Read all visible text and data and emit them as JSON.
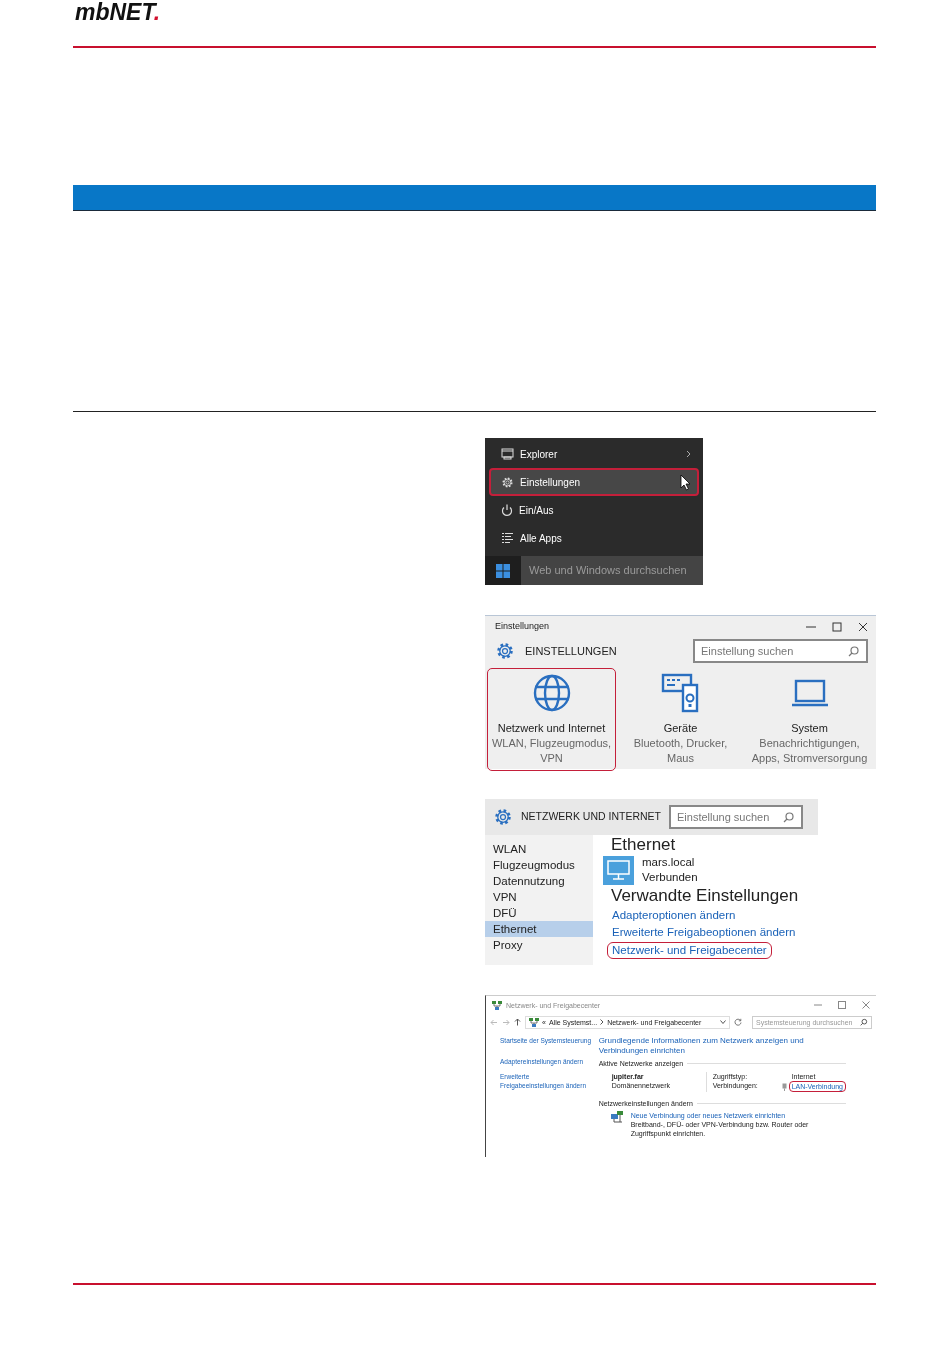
{
  "logo": {
    "text": "mbNET",
    "dot": "."
  },
  "start_menu": {
    "items": [
      {
        "label": "Explorer",
        "kind": "explorer",
        "submenu": true,
        "highlighted": false
      },
      {
        "label": "Einstellungen",
        "kind": "settings",
        "submenu": false,
        "highlighted": true
      },
      {
        "label": "Ein/Aus",
        "kind": "power",
        "submenu": false,
        "highlighted": false
      },
      {
        "label": "Alle Apps",
        "kind": "apps",
        "submenu": false,
        "highlighted": false
      }
    ],
    "search": {
      "placeholder": "Web und Windows durchsuchen"
    }
  },
  "settings_window": {
    "title": "Einstellungen",
    "heading": "EINSTELLUNGEN",
    "search": {
      "placeholder": "Einstellung suchen"
    },
    "tiles": [
      {
        "kind": "network",
        "title": "Netzwerk und Internet",
        "subtitle": "WLAN, Flugzeugmodus, VPN",
        "highlighted": true
      },
      {
        "kind": "devices",
        "title": "Geräte",
        "subtitle": "Bluetooth, Drucker, Maus",
        "highlighted": false
      },
      {
        "kind": "system",
        "title": "System",
        "subtitle": "Benachrichtigungen, Apps, Stromversorgung",
        "highlighted": false
      }
    ]
  },
  "network_settings": {
    "heading": "NETZWERK UND INTERNET",
    "search": {
      "placeholder": "Einstellung suchen"
    },
    "sidebar": {
      "items": [
        {
          "label": "WLAN",
          "selected": false
        },
        {
          "label": "Flugzeugmodus",
          "selected": false
        },
        {
          "label": "Datennutzung",
          "selected": false
        },
        {
          "label": "VPN",
          "selected": false
        },
        {
          "label": "DFÜ",
          "selected": false
        },
        {
          "label": "Ethernet",
          "selected": true
        },
        {
          "label": "Proxy",
          "selected": false
        }
      ]
    },
    "section_title": "Ethernet",
    "connection": {
      "name": "mars.local",
      "status": "Verbunden"
    },
    "related_title": "Verwandte Einstellungen",
    "links": [
      {
        "label": "Adapteroptionen ändern",
        "highlighted": false
      },
      {
        "label": "Erweiterte Freigabeoptionen ändern",
        "highlighted": false
      },
      {
        "label": "Netzwerk- und Freigabecenter",
        "highlighted": true
      }
    ]
  },
  "control_panel": {
    "title": "Netzwerk- und Freigabecenter",
    "breadcrumb_prefix": "«",
    "breadcrumb": [
      "Alle Systemst...",
      "Netzwerk- und Freigabecenter"
    ],
    "search": {
      "placeholder": "Systemsteuerung durchsuchen"
    },
    "sidebar_links": [
      "Startseite der Systemsteuerung",
      "Adaptereinstellungen ändern",
      "Erweiterte Freigabeeinstellungen ändern"
    ],
    "heading": "Grundlegende Informationen zum Netzwerk anzeigen und Verbindungen einrichten",
    "active_networks_label": "Aktive Netzwerke anzeigen",
    "network": {
      "name": "jupiter.far",
      "type": "Domänennetzwerk",
      "access_label": "Zugriffstyp:",
      "access_value": "Internet",
      "connections_label": "Verbindungen:",
      "connection_link": {
        "label": "LAN-Verbindung",
        "highlighted": true
      }
    },
    "change_label": "Netzwerkeinstellungen ändern",
    "new_connection": {
      "link": "Neue Verbindung oder neues Netzwerk einrichten",
      "description": "Breitband-, DFÜ- oder VPN-Verbindung bzw. Router oder Zugriffspunkt einrichten."
    }
  }
}
